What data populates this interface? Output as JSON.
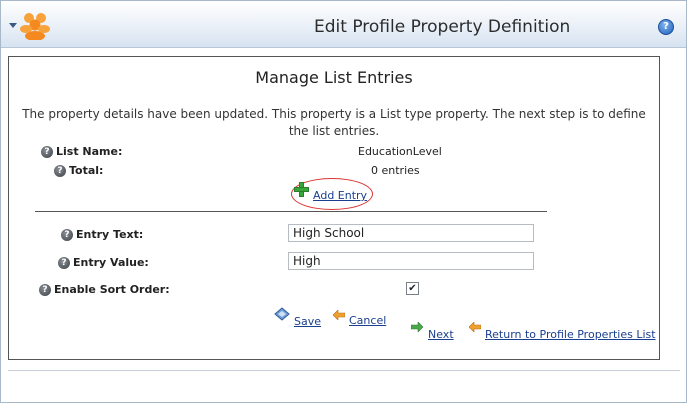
{
  "header": {
    "title": "Edit Profile Property Definition"
  },
  "main": {
    "heading": "Manage List Entries",
    "message": "The property details have been updated. This property is a List type property. The next step is to define the list entries.",
    "list_name_label": "List Name:",
    "list_name_value": "EducationLevel",
    "total_label": "Total:",
    "total_value": "0 entries",
    "add_entry_label": "Add Entry",
    "entry_text_label": "Entry Text:",
    "entry_text_value": "High School",
    "entry_value_label": "Entry Value:",
    "entry_value_value": "High",
    "enable_sort_order_label": "Enable Sort Order:",
    "enable_sort_order_checked": true,
    "save_label": "Save",
    "cancel_label": "Cancel",
    "next_label": "Next",
    "return_label": "Return to Profile Properties List"
  },
  "icons": {
    "help": "help-icon",
    "add": "plus-icon",
    "save": "save-icon",
    "cancel": "back-arrow-icon",
    "next": "forward-arrow-icon",
    "return": "back-arrow-icon"
  },
  "colors": {
    "link": "#1a3f8f",
    "highlight_circle": "#dd3333",
    "plus": "#3aa53a"
  }
}
